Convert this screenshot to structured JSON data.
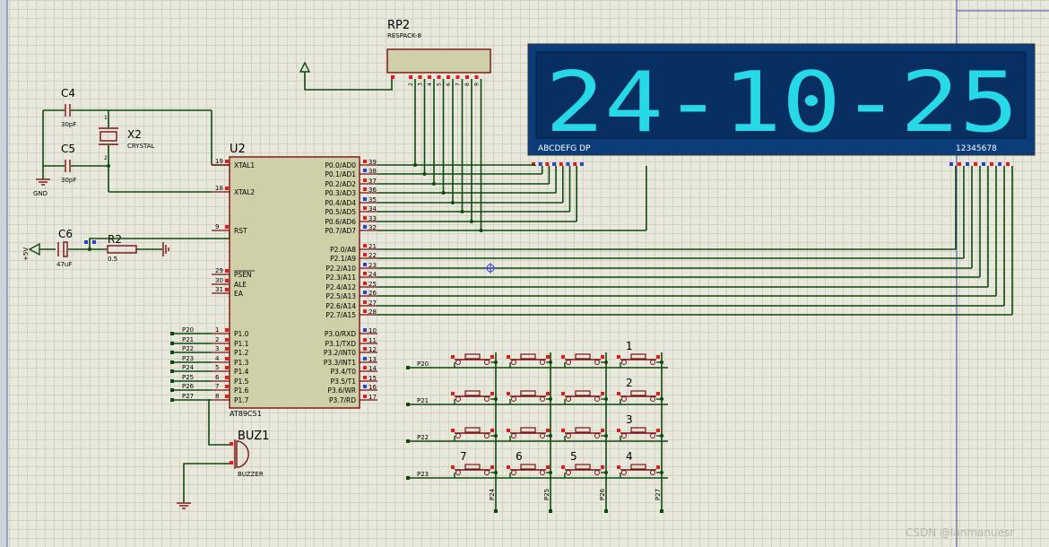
{
  "components": {
    "rp2": {
      "ref": "RP2",
      "value": "RESPACK-8",
      "pins": [
        "2",
        "3",
        "4",
        "5",
        "6",
        "7",
        "8",
        "9"
      ]
    },
    "c4": {
      "ref": "C4",
      "value": "30pF"
    },
    "c5": {
      "ref": "C5",
      "value": "30pF"
    },
    "x2": {
      "ref": "X2",
      "value": "CRYSTAL"
    },
    "gnd": {
      "label": "GND"
    },
    "u2": {
      "ref": "U2",
      "part": "AT89C51"
    },
    "c6": {
      "ref": "C6",
      "value": "47uF"
    },
    "r2": {
      "ref": "R2",
      "value": "0.5"
    },
    "vcc": {
      "label": "+5V"
    },
    "buz1": {
      "ref": "BUZ1",
      "value": "BUZZER"
    }
  },
  "mcu_left_pins": [
    {
      "num": "19",
      "name": "XTAL1"
    },
    {
      "num": "18",
      "name": "XTAL2"
    },
    {
      "num": "9",
      "name": "RST"
    },
    {
      "num": "29",
      "name": "PSEN"
    },
    {
      "num": "30",
      "name": "ALE"
    },
    {
      "num": "31",
      "name": "EA"
    },
    {
      "num": "1",
      "name": "P1.0",
      "net": "P20"
    },
    {
      "num": "2",
      "name": "P1.1",
      "net": "P21"
    },
    {
      "num": "3",
      "name": "P1.2",
      "net": "P22"
    },
    {
      "num": "4",
      "name": "P1.3",
      "net": "P23"
    },
    {
      "num": "5",
      "name": "P1.4",
      "net": "P24"
    },
    {
      "num": "6",
      "name": "P1.5",
      "net": "P25"
    },
    {
      "num": "7",
      "name": "P1.6",
      "net": "P26"
    },
    {
      "num": "8",
      "name": "P1.7",
      "net": "P27"
    }
  ],
  "mcu_right_pins": [
    {
      "num": "39",
      "name": "P0.0/AD0"
    },
    {
      "num": "38",
      "name": "P0.1/AD1"
    },
    {
      "num": "37",
      "name": "P0.2/AD2"
    },
    {
      "num": "36",
      "name": "P0.3/AD3"
    },
    {
      "num": "35",
      "name": "P0.4/AD4"
    },
    {
      "num": "34",
      "name": "P0.5/AD5"
    },
    {
      "num": "33",
      "name": "P0.6/AD6"
    },
    {
      "num": "32",
      "name": "P0.7/AD7"
    },
    {
      "num": "21",
      "name": "P2.0/A8"
    },
    {
      "num": "22",
      "name": "P2.1/A9"
    },
    {
      "num": "23",
      "name": "P2.2/A10"
    },
    {
      "num": "24",
      "name": "P2.3/A11"
    },
    {
      "num": "25",
      "name": "P2.4/A12"
    },
    {
      "num": "26",
      "name": "P2.5/A13"
    },
    {
      "num": "27",
      "name": "P2.6/A14"
    },
    {
      "num": "28",
      "name": "P2.7/A15"
    },
    {
      "num": "10",
      "name": "P3.0/RXD"
    },
    {
      "num": "11",
      "name": "P3.1/TXD"
    },
    {
      "num": "12",
      "name": "P3.2/INT0"
    },
    {
      "num": "13",
      "name": "P3.3/INT1"
    },
    {
      "num": "14",
      "name": "P3.4/T0"
    },
    {
      "num": "15",
      "name": "P3.5/T1"
    },
    {
      "num": "16",
      "name": "P3.6/WR"
    },
    {
      "num": "17",
      "name": "P3.7/RD"
    }
  ],
  "display": {
    "text": "24-10-25",
    "segment_labels": "ABCDEFG  DP",
    "digit_labels": "12345678",
    "bg_color": "#0b3d7a",
    "segment_color": "#27d8e6"
  },
  "keypad": {
    "row_nets": [
      "P20",
      "P21",
      "P22",
      "P23"
    ],
    "col_nets": [
      "P24",
      "P25",
      "P26",
      "P27"
    ],
    "key_labels": [
      {
        "row": 0,
        "col": 3,
        "text": "1"
      },
      {
        "row": 1,
        "col": 3,
        "text": "2"
      },
      {
        "row": 2,
        "col": 3,
        "text": "3"
      },
      {
        "row": 3,
        "col": 0,
        "text": "7"
      },
      {
        "row": 3,
        "col": 1,
        "text": "6"
      },
      {
        "row": 3,
        "col": 2,
        "text": "5"
      },
      {
        "row": 3,
        "col": 3,
        "text": "4"
      }
    ]
  },
  "watermark": "CSDN @lanmanuesr"
}
